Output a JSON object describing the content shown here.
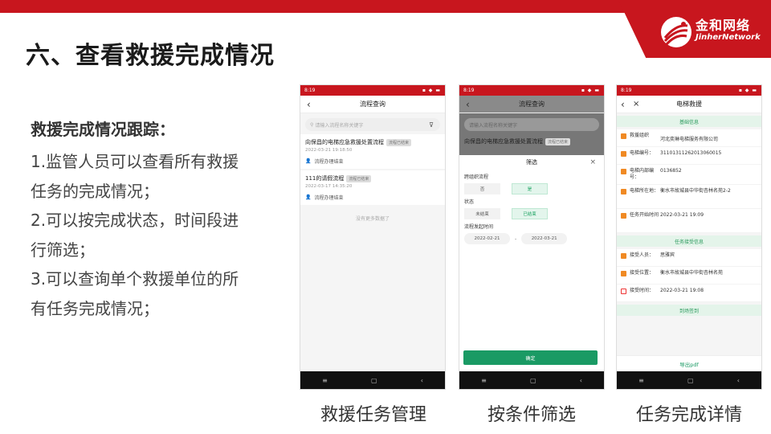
{
  "brand": {
    "name_cn": "金和网络",
    "name_en": "JinherNetwork"
  },
  "page_title": "六、查看救援完成情况",
  "description": {
    "heading": "救援完成情况跟踪：",
    "lines": [
      "1.监管人员可以查看所有救援",
      "任务的完成情况；",
      "2.可以按完成状态，时间段进",
      "行筛选；",
      "3.可以查询单个救援单位的所",
      "有任务完成情况；"
    ]
  },
  "status_bar": {
    "time": "8:19",
    "icons": "▪ ◆ ▬"
  },
  "nav_bar": {
    "menu": "≡",
    "home": "▢",
    "back": "‹"
  },
  "screen1": {
    "title": "流程查询",
    "search_placeholder": "请输入流程名称关键字",
    "items": [
      {
        "title": "向保昌的电梯应急救援处置流程",
        "badge": "流程已结束",
        "date": "2022-03-21 19:18:50",
        "status": "流程办理结束"
      },
      {
        "title": "111的请假流程",
        "badge": "流程已结束",
        "date": "2022-03-17 14:35:20",
        "status": "流程办理结束"
      }
    ],
    "no_more": "没有更多数据了"
  },
  "screen2": {
    "title": "流程查询",
    "search_placeholder": "请输入流程名称关键字",
    "item_title": "向保昌的电梯应急救援处置流程",
    "item_badge": "流程已结束",
    "sheet_title": "筛选",
    "close": "×",
    "cross_org_label": "跨组织流程",
    "cross_org_options": [
      "否",
      "是"
    ],
    "status_label": "状态",
    "status_options": [
      "未结束",
      "已结束"
    ],
    "time_label": "流程发起时间",
    "date_from": "2022-02-21",
    "date_sep": "-",
    "date_to": "2022-03-21",
    "confirm": "确定"
  },
  "screen3": {
    "title": "电梯救援",
    "sections": {
      "basic": "基础信息",
      "accept": "任务接受信息",
      "arrive": "到场签到"
    },
    "basic_fields": [
      {
        "label": "救援组织",
        "value": "河北奕琳电梯服务有限公司"
      },
      {
        "label": "电梯编号：",
        "value": "31101311262013060015"
      },
      {
        "label": "电梯内部编号：",
        "value": "0136852"
      },
      {
        "label": "电梯所在地：",
        "value": "衡水市故城县中华街杏林名苑2-2"
      },
      {
        "label": "任务开始时间",
        "value": "2022-03-21 19:09"
      }
    ],
    "accept_fields": [
      {
        "label": "接受人员：",
        "value": "思雅宾"
      },
      {
        "label": "接受位置：",
        "value": "衡水市故城县中华街杏林名苑"
      },
      {
        "label": "接受时间：",
        "value": "2022-03-21 19:08"
      }
    ],
    "export": "导出pdf"
  },
  "captions": [
    "救援任务管理",
    "按条件筛选",
    "任务完成详情"
  ]
}
